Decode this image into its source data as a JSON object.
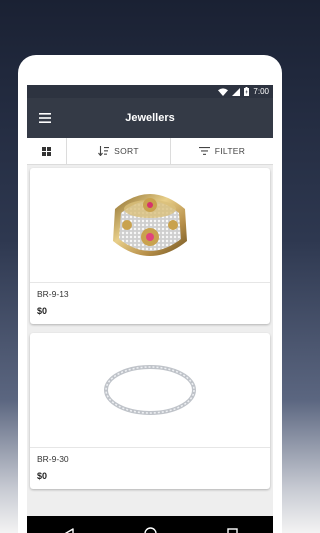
{
  "status_bar": {
    "time": "7:00",
    "icons": [
      "wifi-icon",
      "signal-icon",
      "battery-icon"
    ]
  },
  "toolbar": {
    "title": "Jewellers",
    "menu_icon": "hamburger-menu-icon"
  },
  "action_bar": {
    "grid_icon": "grid-view-icon",
    "sort_label": "SORT",
    "filter_label": "FILTER"
  },
  "products": [
    {
      "sku": "BR-9-13",
      "price": "$0",
      "image": "gold-bangle-image"
    },
    {
      "sku": "BR-9-30",
      "price": "$0",
      "image": "silver-bangle-image"
    }
  ],
  "nav_bar": {
    "icons": [
      "back-icon",
      "home-icon",
      "recents-icon"
    ]
  },
  "colors": {
    "toolbar": "#343a46",
    "status_bar": "#2d3340",
    "nav_bar": "#000000",
    "background_top": "#1a2133"
  }
}
